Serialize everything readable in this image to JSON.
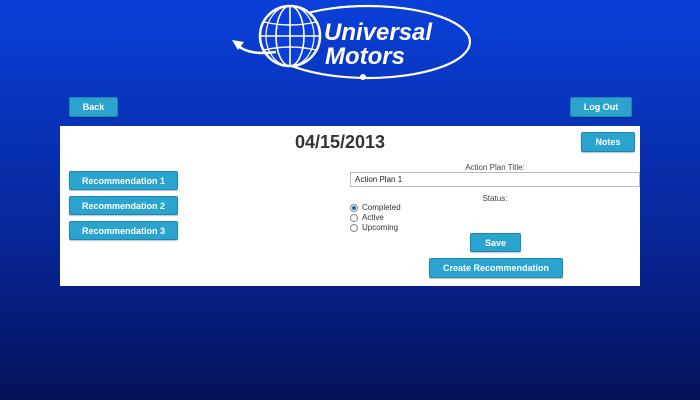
{
  "logo": {
    "line1": "Universal",
    "line2": "Motors"
  },
  "nav": {
    "back_label": "Back",
    "logout_label": "Log Out"
  },
  "panel": {
    "date": "04/15/2013",
    "notes_label": "Notes",
    "recommendations": [
      "Recommendation 1",
      "Recommendation 2",
      "Recommendation 3"
    ],
    "action_plan_title_label": "Action Plan Title:",
    "action_plan_title_value": "Action Plan 1",
    "status_label": "Status:",
    "status_options": [
      "Completed",
      "Active",
      "Upcoming"
    ],
    "status_selected": "Completed",
    "save_label": "Save",
    "create_label": "Create Recommendation"
  },
  "colors": {
    "button": "#2aa3cf",
    "background_top": "#0a3fd9",
    "background_bottom": "#04125a"
  }
}
